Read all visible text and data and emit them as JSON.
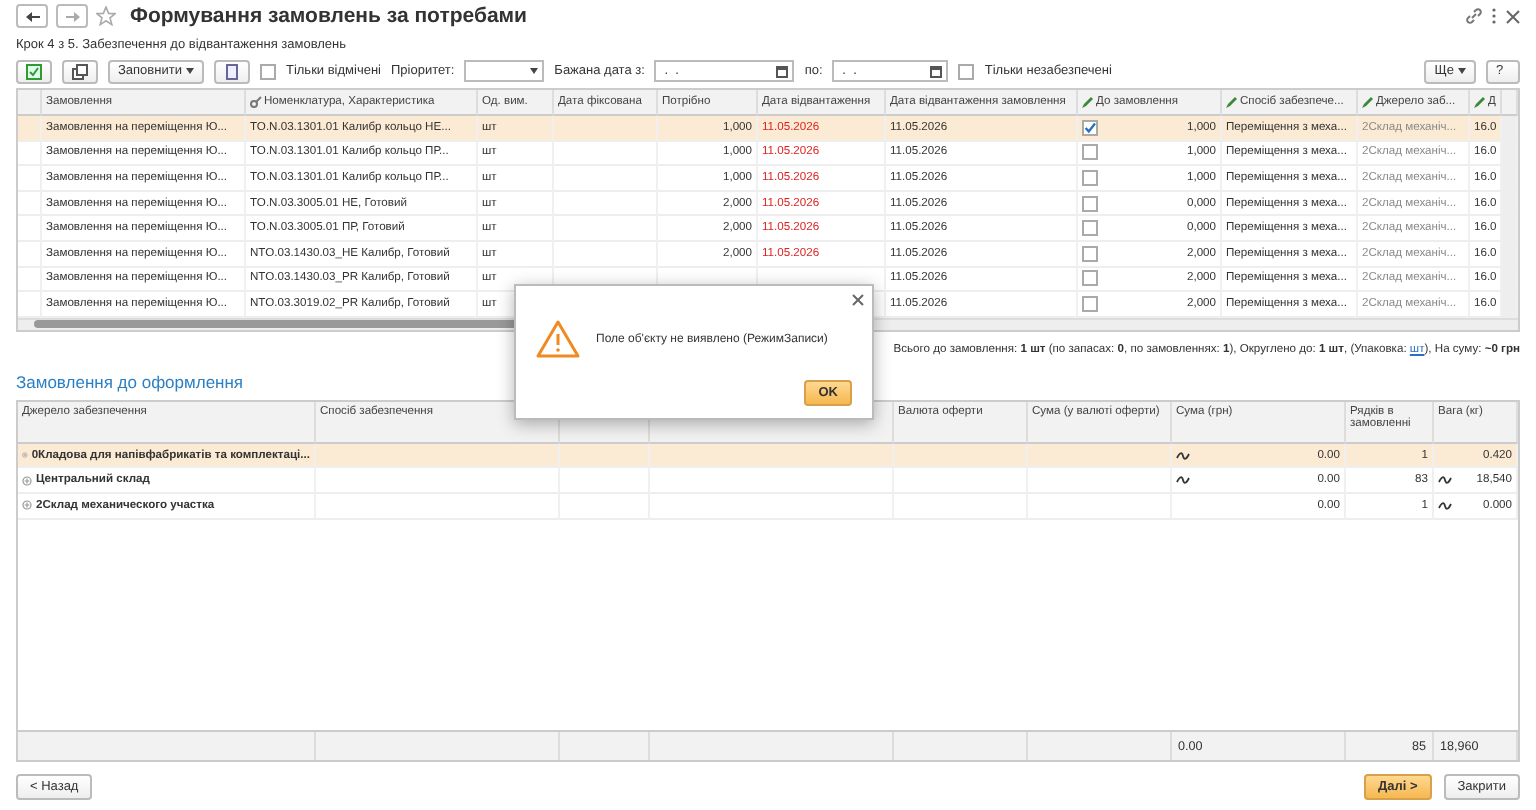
{
  "window": {
    "title": "Формування замовлень за потребами"
  },
  "step": "Крок 4 з 5. Забезпечення до відвантаження замовлень",
  "toolbar": {
    "fill_button": "Заповнити",
    "only_marked": {
      "label": "Тільки відмічені",
      "checked": false
    },
    "priority_label": "Пріоритет:",
    "date_from_label": "Бажана дата з:",
    "date_from_value": " .  . ",
    "date_to_label": "по:",
    "date_to_value": " .  . ",
    "only_unprovided": {
      "label": "Тільки незабезпечені",
      "checked": false
    },
    "more_button": "Ще",
    "help_button": "?"
  },
  "orders_table": {
    "columns": [
      "Замовлення",
      "Номенклатура, Характеристика",
      "Од. вим.",
      "Дата фіксована",
      "Потрібно",
      "Дата відвантаження",
      "Дата відвантаження замовлення",
      "До замовлення",
      "Спосіб забезпече...",
      "Джерело заб...",
      "Д"
    ],
    "rows": [
      {
        "selected": true,
        "order": "Замовлення на переміщення Ю...",
        "item": "TO.N.03.1301.01 Калибр кольцо НЕ...",
        "unit": "шт",
        "needed": "1,000",
        "ship_date": "11.05.2026",
        "order_ship_date": "11.05.2026",
        "checked": true,
        "to_order": "1,000",
        "method": "Переміщення з меха...",
        "source": "2Склад механіч...",
        "column_11": "16.0"
      },
      {
        "selected": false,
        "order": "Замовлення на переміщення Ю...",
        "item": "TO.N.03.1301.01 Калибр кольцо ПР...",
        "unit": "шт",
        "needed": "1,000",
        "ship_date": "11.05.2026",
        "order_ship_date": "11.05.2026",
        "checked": false,
        "to_order": "1,000",
        "method": "Переміщення з меха...",
        "source": "2Склад механіч...",
        "column_11": "16.0"
      },
      {
        "selected": false,
        "order": "Замовлення на переміщення Ю...",
        "item": "TO.N.03.1301.01 Калибр кольцо ПР...",
        "unit": "шт",
        "needed": "1,000",
        "ship_date": "11.05.2026",
        "order_ship_date": "11.05.2026",
        "checked": false,
        "to_order": "1,000",
        "method": "Переміщення з меха...",
        "source": "2Склад механіч...",
        "column_11": "16.0"
      },
      {
        "selected": false,
        "order": "Замовлення на переміщення Ю...",
        "item": "TO.N.03.3005.01 НЕ, Готовий",
        "unit": "шт",
        "needed": "2,000",
        "ship_date": "11.05.2026",
        "order_ship_date": "11.05.2026",
        "checked": false,
        "to_order": "0,000",
        "method": "Переміщення з меха...",
        "source": "2Склад механіч...",
        "column_11": "16.0"
      },
      {
        "selected": false,
        "order": "Замовлення на переміщення Ю...",
        "item": "TO.N.03.3005.01 ПР, Готовий",
        "unit": "шт",
        "needed": "2,000",
        "ship_date": "11.05.2026",
        "order_ship_date": "11.05.2026",
        "checked": false,
        "to_order": "0,000",
        "method": "Переміщення з меха...",
        "source": "2Склад механіч...",
        "column_11": "16.0"
      },
      {
        "selected": false,
        "order": "Замовлення на переміщення Ю...",
        "item": "NTO.03.1430.03_НЕ Калибр, Готовий",
        "unit": "шт",
        "needed": "2,000",
        "ship_date": "11.05.2026",
        "order_ship_date": "11.05.2026",
        "checked": false,
        "to_order": "2,000",
        "method": "Переміщення з меха...",
        "source": "2Склад механіч...",
        "column_11": "16.0"
      },
      {
        "selected": false,
        "order": "Замовлення на переміщення Ю...",
        "item": "NTO.03.1430.03_PR Калибр, Готовий",
        "unit": "шт",
        "order_ship_date": "11.05.2026",
        "checked": false,
        "to_order": "2,000",
        "method": "Переміщення з меха...",
        "source": "2Склад механіч...",
        "column_11": "16.0"
      },
      {
        "selected": false,
        "order": "Замовлення на переміщення Ю...",
        "item": "NTO.03.3019.02_PR Калибр, Готовий",
        "unit": "шт",
        "order_ship_date": "11.05.2026",
        "checked": false,
        "to_order": "2,000",
        "method": "Переміщення з меха...",
        "source": "2Склад механіч...",
        "column_11": "16.0"
      }
    ]
  },
  "summary": "Всього до замовлення: **1 шт** (по запасах: **0**, по замовленнях: **1**), Округлено до: **1 шт**, (Упаковка: ",
  "summary_link": "шт",
  "summary_end": "), На суму: **~0 грн**",
  "section_title": "Замовлення до оформлення",
  "draft_table": {
    "columns": [
      "Джерело забезпечення",
      "Спосіб забезпечення",
      "",
      "",
      "Валюта оферти",
      "Сума (у валюті оферти)",
      "Сума (грн)",
      "Рядків в замовленні",
      "Вага (кг)"
    ],
    "rows": [
      {
        "selected": true,
        "source": "0Кладова для напівфабрикатів та комплектаці...",
        "sum_approx": true,
        "sum": "0.00",
        "lines": "1",
        "weight_approx": false,
        "weight": "0.420"
      },
      {
        "selected": false,
        "source": "Центральний склад",
        "sum_approx": true,
        "sum": "0.00",
        "lines": "83",
        "weight_approx": true,
        "weight": "18,540"
      },
      {
        "selected": false,
        "source": "2Склад механического участка",
        "sum_approx": false,
        "sum": "0.00",
        "lines": "1",
        "weight_approx": true,
        "weight": "0.000"
      }
    ],
    "totals": {
      "sum": "0.00",
      "lines": "85",
      "weight": "18,960"
    }
  },
  "buttons": {
    "back": "< Назад",
    "next": "Далі >",
    "close": "Закрити"
  },
  "dialog": {
    "message": "Поле об'єкту не виявлено (РежимЗаписи)",
    "ok": "OK"
  }
}
